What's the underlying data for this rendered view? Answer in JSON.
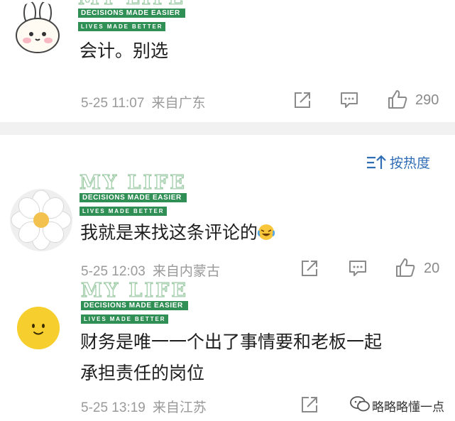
{
  "watermark": {
    "title": "MY LIFE",
    "line1": "DECISIONS MADE EASIER",
    "line2": "LIVES MADE BETTER"
  },
  "comments": [
    {
      "text": "会计。别选",
      "date": "5-25 11:07",
      "location": "来自广东",
      "likes": "290"
    },
    {
      "text": "我就是来找这条评论的",
      "date": "5-25 12:03",
      "location": "来自内蒙古",
      "likes": "20"
    },
    {
      "text_line1": "财务是唯一一个出了事情要和老板一起",
      "text_line2": "承担责任的岗位",
      "date": "5-25 13:19",
      "location": "来自江苏"
    }
  ],
  "sort_label": "按热度",
  "source_label": "略略略懂一点",
  "icons": {
    "share": "share-icon",
    "comment": "comment-icon",
    "like": "thumbs-up-icon",
    "sort": "sort-icon",
    "emoji": "laughing-tears-emoji",
    "wechat": "wechat-icon"
  },
  "colors": {
    "accent": "#2f6db5",
    "watermark_green": "#2f8f54",
    "meta_gray": "#9a9a9a",
    "divider": "#f1f1f1"
  }
}
